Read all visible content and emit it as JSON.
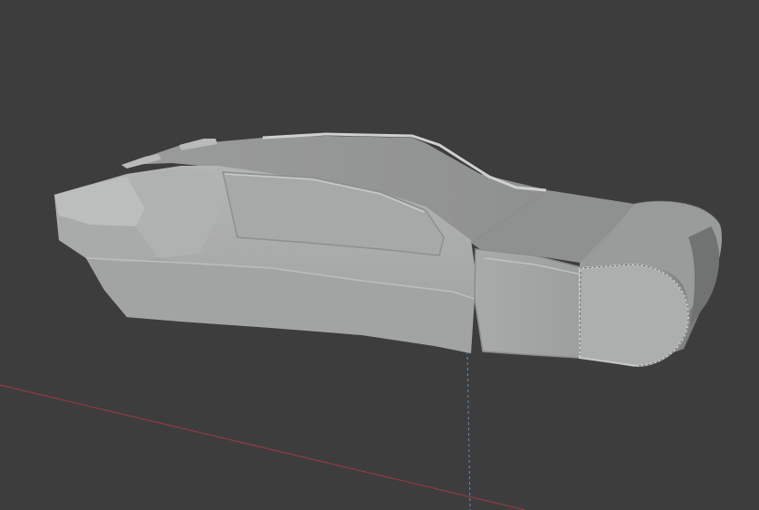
{
  "app": {
    "name": "3D Viewport",
    "mode": "solid-shading"
  },
  "viewport": {
    "background_color": "#3d3d3d",
    "axes": {
      "x_axis_color": "#a23a44",
      "z_axis_color": "#5b8cc7"
    },
    "model": {
      "name": "hover-car",
      "base_color": "#a8a9a9"
    }
  }
}
